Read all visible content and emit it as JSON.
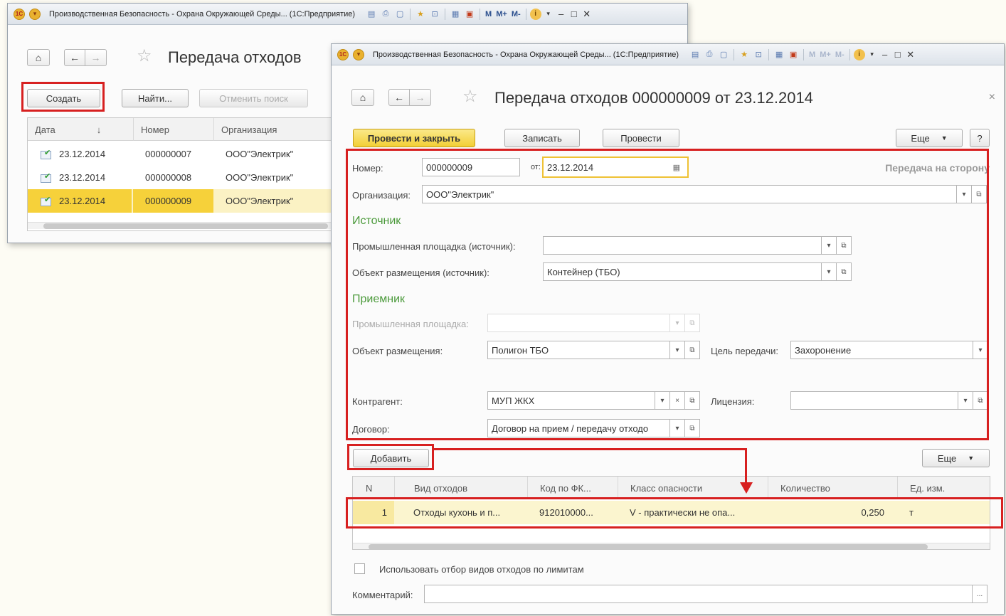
{
  "back_window": {
    "titlebar": {
      "title": "Производственная Безопасность - Охрана Окружающей Среды... (1С:Предприятие)",
      "m_labels": [
        "M",
        "M+",
        "M-"
      ]
    },
    "form_title": "Передача отходов",
    "buttons": {
      "create": "Создать",
      "find": "Найти...",
      "cancel_search": "Отменить поиск"
    },
    "table": {
      "columns": [
        "Дата",
        "Номер",
        "Организация"
      ],
      "sort_indicator": "↓",
      "rows": [
        {
          "date": "23.12.2014",
          "number": "000000007",
          "org": "ООО\"Электрик\""
        },
        {
          "date": "23.12.2014",
          "number": "000000008",
          "org": "ООО\"Электрик\""
        },
        {
          "date": "23.12.2014",
          "number": "000000009",
          "org": "ООО\"Электрик\""
        }
      ],
      "selected_row": 2
    }
  },
  "front_window": {
    "titlebar": {
      "title": "Производственная Безопасность - Охрана Окружающей Среды... (1С:Предприятие)",
      "m_labels": [
        "M",
        "M+",
        "M-"
      ]
    },
    "form_title": "Передача отходов 000000009 от 23.12.2014",
    "close_glyph": "×",
    "toolbar": {
      "post_close": "Провести и закрыть",
      "save": "Записать",
      "post": "Провести",
      "more": "Еще",
      "help": "?"
    },
    "header": {
      "number_label": "Номер:",
      "number_value": "000000009",
      "from_label": "от:",
      "date_value": "23.12.2014",
      "type_caption": "Передача на сторону",
      "org_label": "Организация:",
      "org_value": "ООО\"Электрик\""
    },
    "source": {
      "section": "Источник",
      "site_label": "Промышленная площадка (источник):",
      "site_value": "",
      "object_label": "Объект размещения (источник):",
      "object_value": "Контейнер (ТБО)"
    },
    "receiver": {
      "section": "Приемник",
      "site_label": "Промышленная площадка:",
      "site_value": "",
      "object_label": "Объект размещения:",
      "object_value": "Полигон  ТБО",
      "purpose_label": "Цель передачи:",
      "purpose_value": "Захоронение",
      "counterparty_label": "Контрагент:",
      "counterparty_value": "МУП ЖКХ",
      "license_label": "Лицензия:",
      "license_value": "",
      "contract_label": "Договор:",
      "contract_value": "Договор на прием / передачу отходо"
    },
    "tabular": {
      "add": "Добавить",
      "more": "Еще",
      "columns": [
        "N",
        "Вид отходов",
        "Код по ФК...",
        "Класс опасности",
        "Количество",
        "Ед. изм."
      ],
      "rows": [
        {
          "n": "1",
          "waste": "Отходы кухонь и п...",
          "code": "912010000...",
          "hazard": "V - практически не опа...",
          "qty": "0,250",
          "unit": "т"
        }
      ]
    },
    "limit_filter_label": "Использовать отбор видов отходов по лимитам",
    "comment_label": "Комментарий:",
    "comment_value": "",
    "ellipsis": "..."
  }
}
